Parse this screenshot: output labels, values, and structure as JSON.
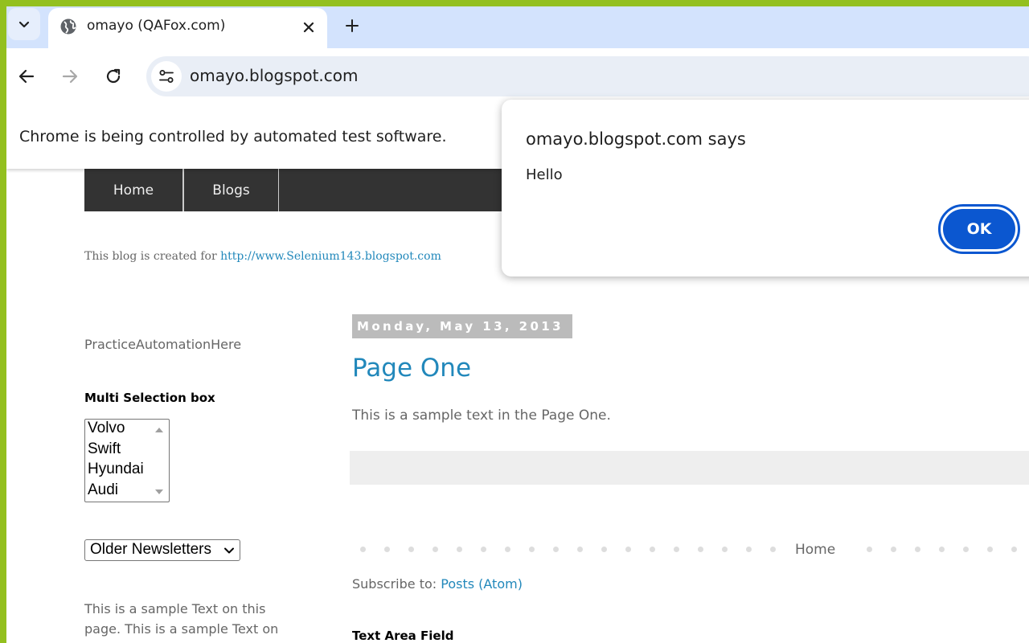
{
  "browser": {
    "tab": {
      "title": "omayo (QAFox.com)"
    },
    "address_bar": {
      "url": "omayo.blogspot.com"
    },
    "icons": {
      "tab_menu": "chevron-down-icon",
      "favicon": "globe-icon",
      "close": "close-icon",
      "new_tab": "plus-icon",
      "back": "arrow-left-icon",
      "forward": "arrow-right-icon",
      "reload": "reload-icon",
      "site_info": "tune-icon"
    }
  },
  "infobar": {
    "text": "Chrome is being controlled by automated test software."
  },
  "page": {
    "nav": [
      "Home",
      "Blogs"
    ],
    "created_prefix": "This blog is created for",
    "created_link": "http://www.Selenium143.blogspot.com",
    "sidebar": {
      "title": "PracticeAutomationHere",
      "multi_heading": "Multi Selection box",
      "multi_options": [
        "Volvo",
        "Swift",
        "Hyundai",
        "Audi"
      ],
      "dropdown_selected": "Older Newsletters",
      "sample_text": "This is a sample Text on this page. This is a sample Text on"
    },
    "post": {
      "date": "Monday, May 13, 2013",
      "title": "Page One",
      "body": "This is a sample text in the Page One."
    },
    "footer_nav": {
      "home": "Home"
    },
    "subscribe": {
      "label": "Subscribe to:",
      "link": "Posts (Atom)"
    },
    "text_area_heading": "Text Area Field"
  },
  "dialog": {
    "title": "omayo.blogspot.com says",
    "message": "Hello",
    "ok_label": "OK"
  },
  "colors": {
    "window_frame": "#93c01f",
    "tabstrip": "#d3e3fd",
    "omnibox": "#e9eef6",
    "link": "#2288bb",
    "nav_bar": "#333333",
    "date_header": "#bbbbbb",
    "ok_button": "#0b57d0"
  }
}
